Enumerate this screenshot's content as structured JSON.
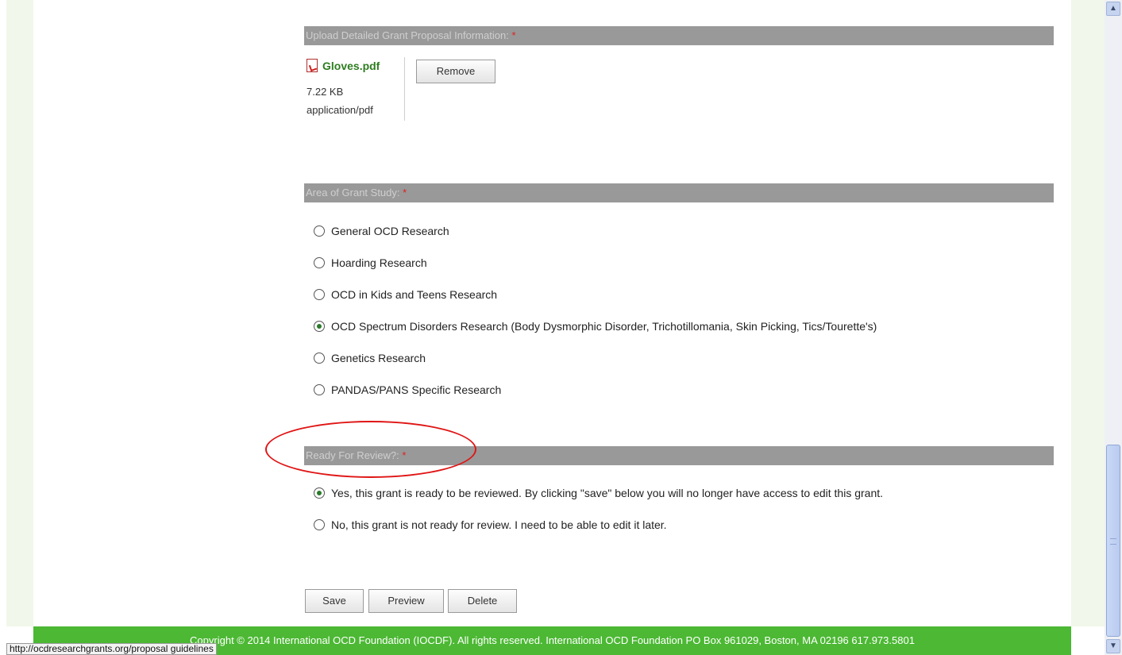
{
  "upload_section": {
    "label": "Upload Detailed Grant Proposal Information:",
    "required_mark": "*",
    "file": {
      "icon": "pdf-icon",
      "name": "Gloves.pdf",
      "size": "7.22 KB",
      "mime": "application/pdf"
    },
    "remove_label": "Remove"
  },
  "area_section": {
    "label": "Area of Grant Study:",
    "required_mark": "*",
    "options": [
      {
        "label": "General OCD Research",
        "checked": false
      },
      {
        "label": "Hoarding Research",
        "checked": false
      },
      {
        "label": "OCD in Kids and Teens Research",
        "checked": false
      },
      {
        "label": "OCD Spectrum Disorders Research (Body Dysmorphic Disorder, Trichotillomania, Skin Picking, Tics/Tourette's)",
        "checked": true
      },
      {
        "label": "Genetics Research",
        "checked": false
      },
      {
        "label": "PANDAS/PANS Specific Research",
        "checked": false
      }
    ]
  },
  "review_section": {
    "label": "Ready For Review?:",
    "required_mark": "*",
    "options": [
      {
        "label": "Yes, this grant is ready to be reviewed. By clicking \"save\" below you will no longer have access to edit this grant.",
        "checked": true
      },
      {
        "label": "No, this grant is not ready for review. I need to be able to edit it later.",
        "checked": false
      }
    ]
  },
  "actions": {
    "save_label": "Save",
    "preview_label": "Preview",
    "delete_label": "Delete"
  },
  "footer": {
    "text": "Copyright © 2014 International OCD Foundation (IOCDF). All rights reserved. International OCD Foundation PO Box 961029, Boston, MA 02196 617.973.5801"
  },
  "status_bar": {
    "url": "http://ocdresearchgrants.org/proposal guidelines"
  },
  "colors": {
    "section_bar": "#999999",
    "footer_green": "#4cb834",
    "page_bg": "#f1f7ea",
    "annotation_red": "#e01515"
  }
}
